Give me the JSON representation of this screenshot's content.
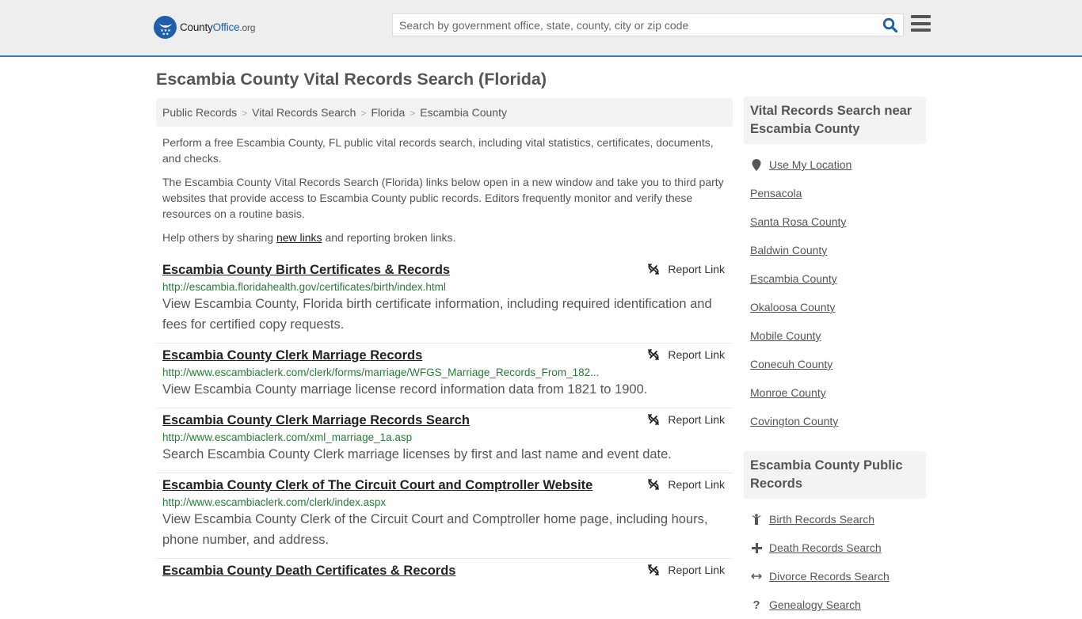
{
  "header": {
    "logo": {
      "county": "County",
      "office": "Office",
      "org": ".org"
    },
    "search": {
      "placeholder": "Search by government office, state, county, city or zip code",
      "value": ""
    },
    "icons": {
      "search": "search-icon",
      "menu": "hamburger-menu-icon"
    }
  },
  "page": {
    "title": "Escambia County Vital Records Search (Florida)",
    "breadcrumb": [
      "Public Records",
      "Vital Records Search",
      "Florida",
      "Escambia County"
    ],
    "intro": {
      "p1": "Perform a free Escambia County, FL public vital records search, including vital statistics, certificates, documents, and checks.",
      "p2": "The Escambia County Vital Records Search (Florida) links below open in a new window and take you to third party websites that provide access to Escambia County public records. Editors frequently monitor and verify these resources on a routine basis.",
      "p3_before": "Help others by sharing ",
      "p3_link": "new links",
      "p3_after": " and reporting broken links."
    }
  },
  "results": [
    {
      "title": "Escambia County Birth Certificates & Records",
      "url": "http://escambia.floridahealth.gov/certificates/birth/index.html",
      "description": "View Escambia County, Florida birth certificate information, including required identification and fees for certified copy requests.",
      "report_label": "Report Link"
    },
    {
      "title": "Escambia County Clerk Marriage Records",
      "url": "http://www.escambiaclerk.com/clerk/forms/marriage/WFGS_Marriage_Records_From_182...",
      "description": "View Escambia County marriage license record information data from 1821 to 1900.",
      "report_label": "Report Link"
    },
    {
      "title": "Escambia County Clerk Marriage Records Search",
      "url": "http://www.escambiaclerk.com/xml_marriage_1a.asp",
      "description": "Search Escambia County Clerk marriage licenses by first and last name and event date.",
      "report_label": "Report Link"
    },
    {
      "title": "Escambia County Clerk of The Circuit Court and Comptroller Website",
      "url": "http://www.escambiaclerk.com/clerk/index.aspx",
      "description": "View Escambia County Clerk of the Circuit Court and Comptroller home page, including hours, phone number, and address.",
      "report_label": "Report Link"
    },
    {
      "title": "Escambia County Death Certificates & Records",
      "url": "",
      "description": "",
      "report_label": "Report Link"
    }
  ],
  "sidebar": {
    "nearby": {
      "heading": "Vital Records Search near Escambia County",
      "use_location": "Use My Location",
      "items": [
        "Pensacola",
        "Santa Rosa County",
        "Baldwin County",
        "Escambia County",
        "Okaloosa County",
        "Mobile County",
        "Conecuh County",
        "Monroe County",
        "Covington County"
      ]
    },
    "public_records": {
      "heading": "Escambia County Public Records",
      "items": [
        {
          "label": "Birth Records Search",
          "icon": "child-icon"
        },
        {
          "label": "Death Records Search",
          "icon": "plus-icon"
        },
        {
          "label": "Divorce Records Search",
          "icon": "arrows-horizontal-icon"
        },
        {
          "label": "Genealogy Search",
          "icon": "question-icon"
        }
      ]
    }
  },
  "colors": {
    "brand_blue": "#1f5ea8",
    "header_border": "#3a7bb0",
    "url_green": "#2a7a3a",
    "header_bg": "#eeeeee"
  }
}
